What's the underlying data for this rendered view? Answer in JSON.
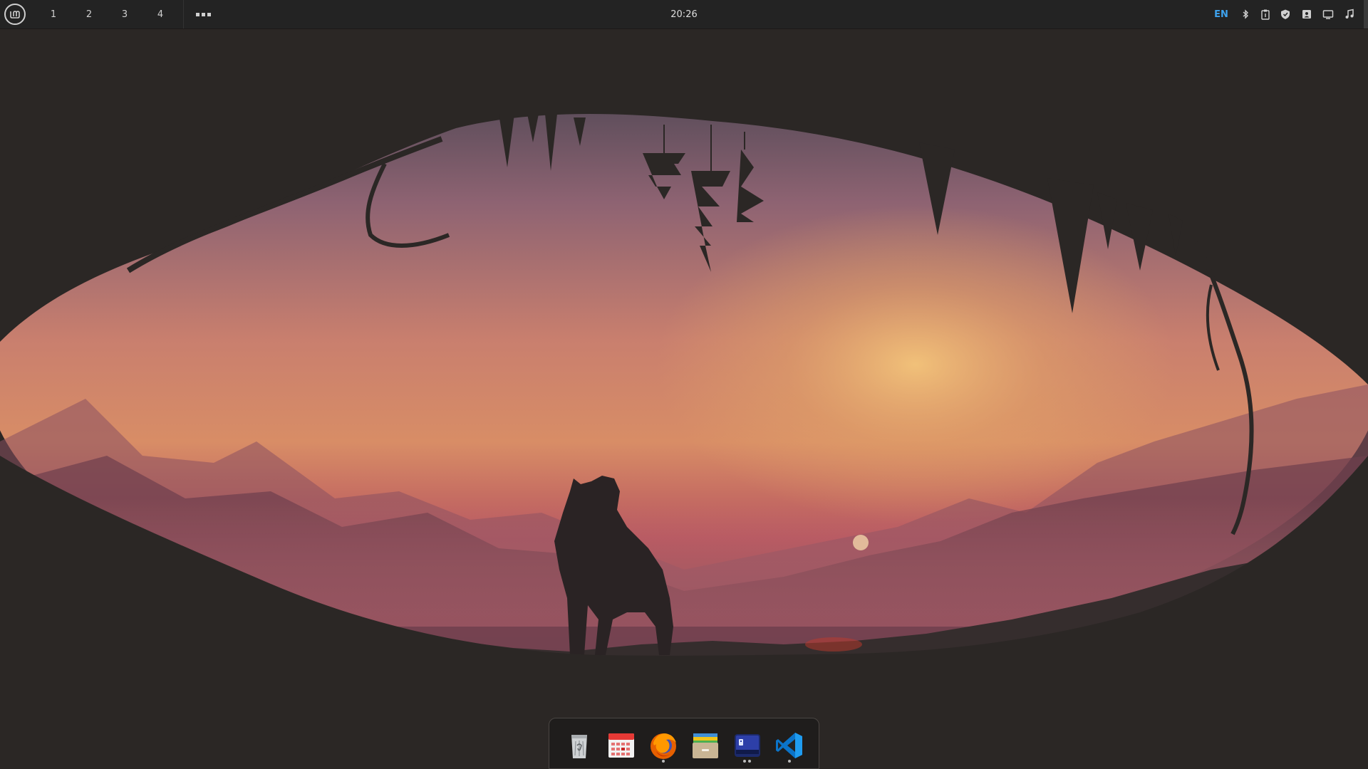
{
  "panel": {
    "menu_icon": "linux-mint-logo-icon",
    "workspaces": [
      "1",
      "2",
      "3",
      "4"
    ],
    "more_icon": "more-dots-icon",
    "clock": "20:26",
    "language": "EN",
    "tray_icons": [
      "bluetooth-icon",
      "clipboard-icon",
      "shield-icon",
      "user-icon",
      "display-icon",
      "music-icon"
    ]
  },
  "dock": {
    "apps": [
      {
        "name": "trash-icon",
        "running": false
      },
      {
        "name": "calendar-icon",
        "running": false
      },
      {
        "name": "firefox-icon",
        "running": true
      },
      {
        "name": "archive-manager-icon",
        "running": false
      },
      {
        "name": "terminal-icon",
        "running": true
      },
      {
        "name": "vscode-icon",
        "running": true
      }
    ]
  },
  "colors": {
    "panel": "#232323",
    "accent": "#3ea3ef",
    "cave": "#2b2725"
  }
}
